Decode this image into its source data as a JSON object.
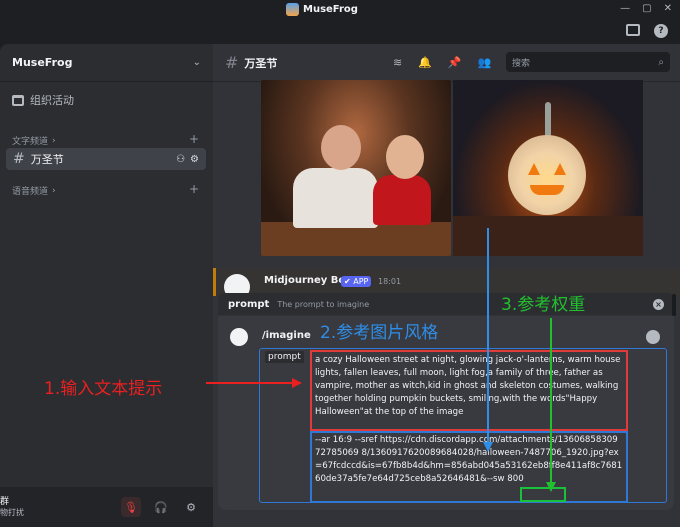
{
  "titlebar": {
    "app_name": "MuseFrog",
    "win_controls": [
      "—",
      "▢",
      "✕"
    ]
  },
  "server": {
    "name": "MuseFrog",
    "events_label": "组织活动",
    "text_category": "文字频道",
    "voice_category": "语音频道",
    "channels": [
      {
        "name": "万圣节",
        "active": true
      }
    ]
  },
  "user": {
    "name": "群",
    "status": "物打扰"
  },
  "channel_header": {
    "title": "万圣节",
    "search_placeholder": "搜索"
  },
  "message": {
    "author": "Midjourney Bot",
    "badge": "✔ APP",
    "time": "18:01"
  },
  "command": {
    "option_name": "prompt",
    "option_desc": "The prompt to imagine",
    "slash": "/imagine",
    "field_label": "prompt",
    "prompt_text": "a cozy Halloween street at night, glowing jack-o'-lanterns, warm house lights, fallen leaves, full moon, light fog,a family of three, father as vampire, mother as witch,kid in ghost and skeleton costumes, walking together holding pumpkin buckets, smiling,with the words\"Happy Halloween\"at the top of the image",
    "params_text": "--ar 16:9 --sref https://cdn.discordapp.com/attachments/1360685830972785069 8/1360917620089684028/halloween-7487706_1920.jpg?ex=67fcdccd&is=67fb8b4d&hm=856abd045a53162eb8ff8e411af8c768160de37a5fe7e64d725ceb8a52646481&",
    "sw_text": "--sw 800"
  },
  "annotations": {
    "input_prompt": "1.输入文本提示",
    "ref_style": "2.参考图片风格",
    "ref_weight": "3.参考权重"
  },
  "colors": {
    "red": "#e03b3b",
    "blue": "#2f78d6",
    "green": "#19c23a",
    "accent": "#5865f2"
  }
}
